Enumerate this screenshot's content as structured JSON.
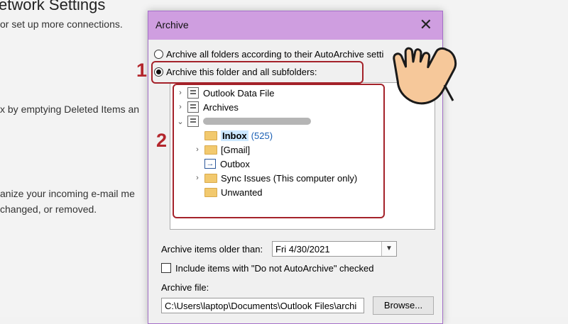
{
  "background": {
    "title_partial": "etwork Settings",
    "line1": "or set up more connections.",
    "line2": "x by emptying Deleted Items an",
    "line3": "anize your incoming e-mail me",
    "line4": "changed, or removed."
  },
  "dialog": {
    "title": "Archive",
    "close_glyph": "✕",
    "radio_all": "Archive all folders according to their AutoArchive setti",
    "radio_this": "Archive this folder and all subfolders:",
    "tree": [
      {
        "label": "Outlook Data File"
      },
      {
        "label": "Archives"
      },
      {
        "label": ""
      },
      {
        "label": "Inbox",
        "count": "(525)"
      },
      {
        "label": "[Gmail]"
      },
      {
        "label": "Outbox"
      },
      {
        "label": "Sync Issues (This computer only)"
      },
      {
        "label": "Unwanted"
      }
    ],
    "older_than_label": "Archive items older than:",
    "older_than_value": "Fri 4/30/2021",
    "include_label": "Include items with \"Do not AutoArchive\" checked",
    "archive_file_label": "Archive file:",
    "archive_file_value": "C:\\Users\\laptop\\Documents\\Outlook Files\\archi",
    "browse_label": "Browse..."
  },
  "annotations": {
    "step1": "1",
    "step2": "2",
    "color": "#a4222a"
  },
  "colors": {
    "titlebar": "#cf9ee0",
    "accent_link": "#1a5fb4"
  }
}
